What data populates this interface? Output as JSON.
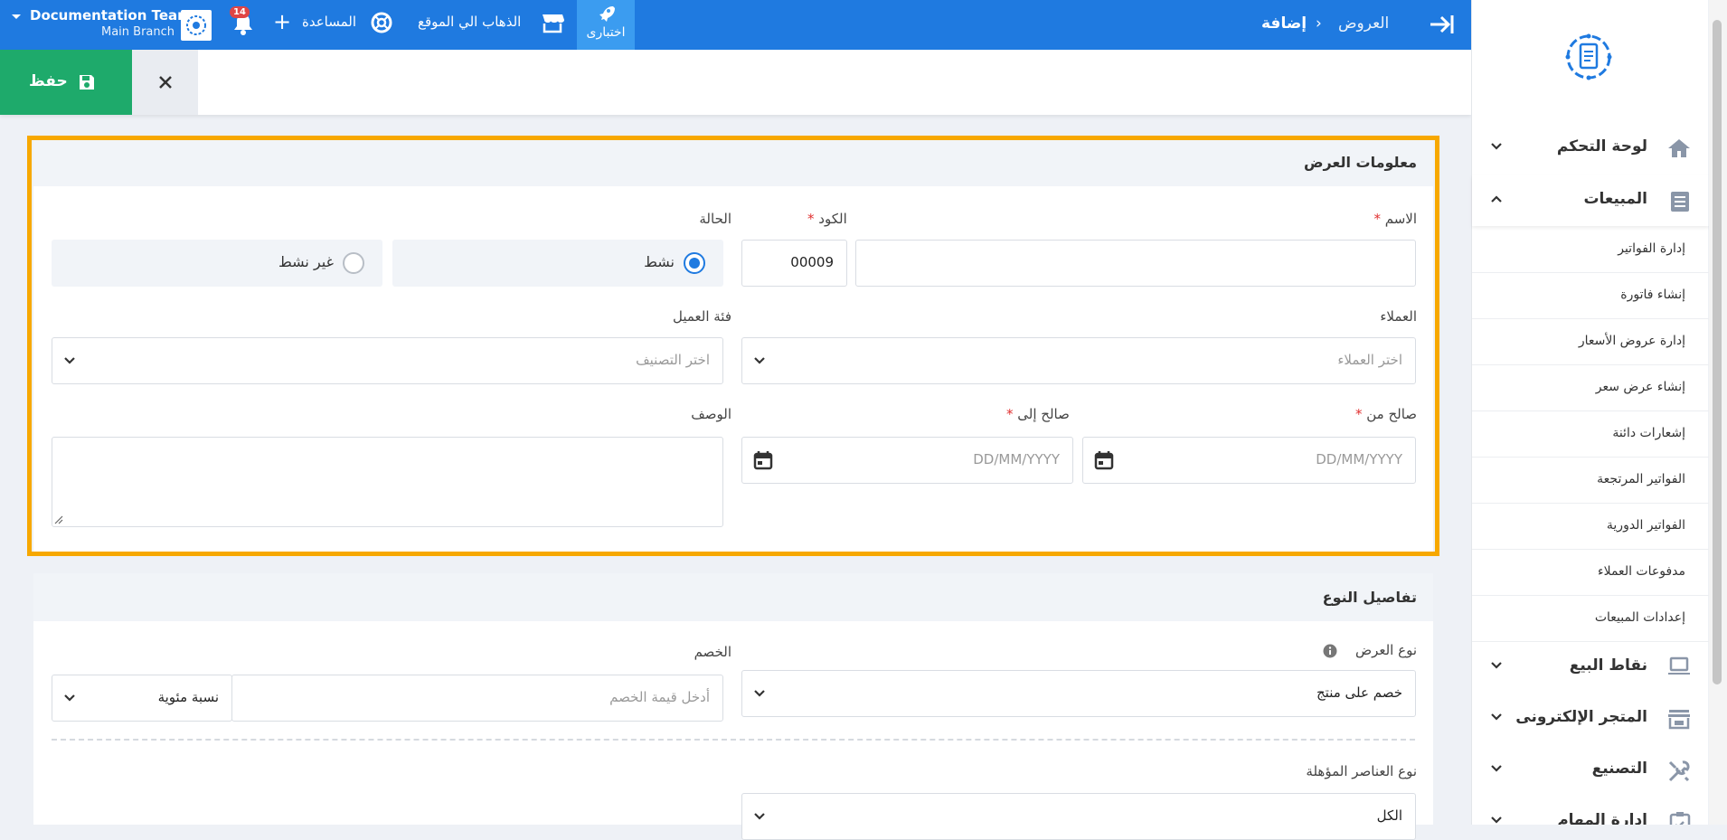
{
  "topbar": {
    "org_name": "Documentation Team",
    "branch": "Main Branch",
    "notifications_count": "14",
    "add": "+",
    "help_label": "المساعدة",
    "go_site_label": "الذهاب الي الموقع",
    "trial_label": "اختبارى",
    "breadcrumb": {
      "parent": "العروض",
      "separator": "›",
      "current": "إضافة"
    },
    "colors": {
      "bar": "#1f7ae0",
      "trial": "#3b9cf0",
      "badge": "#e04545"
    }
  },
  "actionbar": {
    "save_label": "حفظ",
    "save_color": "#1eaa6b"
  },
  "sidebar": {
    "main_items": [
      {
        "label": "لوحة التحكم",
        "icon": "home-icon"
      },
      {
        "label": "المبيعات",
        "icon": "sales-icon",
        "expanded": true
      },
      {
        "label": "نقاط البيع",
        "icon": "laptop-icon"
      },
      {
        "label": "المتجر الإلكترونى",
        "icon": "store-icon"
      },
      {
        "label": "التصنيع",
        "icon": "tools-icon"
      },
      {
        "label": "إدارة المهام",
        "icon": "tasks-icon"
      }
    ],
    "sales_sub_items": [
      "إدارة الفواتير",
      "إنشاء فاتورة",
      "إدارة عروض الأسعار",
      "إنشاء عرض سعر",
      "إشعارات دائنة",
      "الفواتير المرتجعة",
      "الفواتير الدورية",
      "مدفوعات العملاء",
      "إعدادات المبيعات"
    ]
  },
  "offer_info": {
    "title": "معلومات العرض",
    "name_label": "الاسم",
    "name_value": "",
    "code_label": "الكود",
    "code_value": "00009",
    "status_label": "الحالة",
    "status_active": "نشط",
    "status_inactive": "غير نشط",
    "status_selected": "نشط",
    "customers_label": "العملاء",
    "customers_placeholder": "اختر العملاء",
    "customer_category_label": "فئة العميل",
    "customer_category_placeholder": "اختر التصنيف",
    "valid_from_label": "صالح من",
    "valid_from_placeholder": "DD/MM/YYYY",
    "valid_to_label": "صالح إلى",
    "valid_to_placeholder": "DD/MM/YYYY",
    "description_label": "الوصف",
    "required_mark": "*",
    "highlight_color": "#f7a800"
  },
  "type_details": {
    "title": "تفاصيل النوع",
    "offer_type_label": "نوع العرض",
    "offer_type_value": "خصم على منتج",
    "discount_label": "الخصم",
    "discount_placeholder": "أدخل قيمة الخصم",
    "discount_unit": "نسبة مئوية",
    "eligible_items_label": "نوع العناصر المؤهلة",
    "eligible_items_value": "الكل"
  }
}
